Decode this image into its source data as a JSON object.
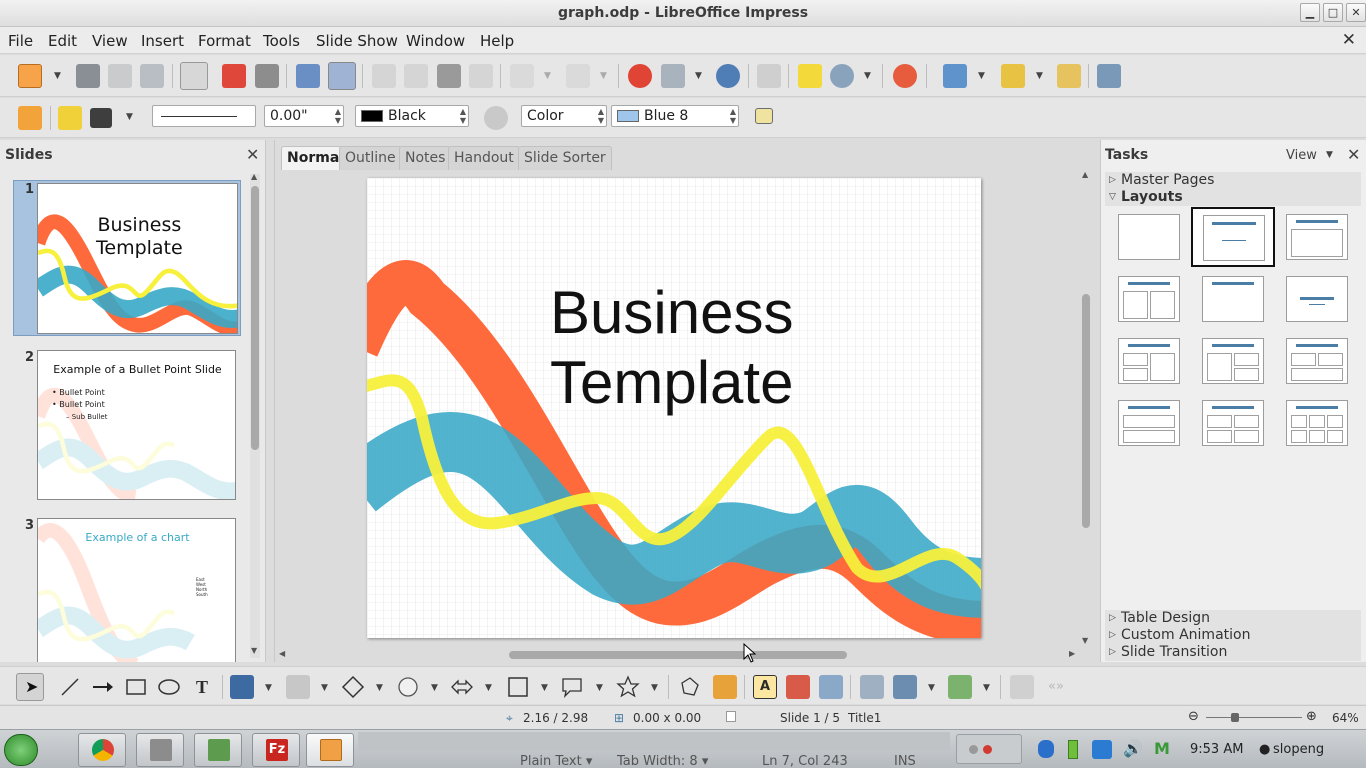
{
  "window": {
    "title": "graph.odp - LibreOffice Impress",
    "minimize": "▁",
    "maximize": "□",
    "close": "✕"
  },
  "menu": [
    "File",
    "Edit",
    "View",
    "Insert",
    "Format",
    "Tools",
    "Slide Show",
    "Window",
    "Help"
  ],
  "doc_close": "✕",
  "line_toolbar": {
    "line_width": "0.00\"",
    "line_color": "Black",
    "line_color_hex": "#000000",
    "area_style": "Color",
    "area_fill": "Blue 8",
    "area_fill_hex": "#9fc6ea"
  },
  "slides_panel": {
    "title": "Slides",
    "close": "✕",
    "thumbnails": [
      {
        "number": "1",
        "title_line1": "Business",
        "title_line2": "Template"
      },
      {
        "number": "2",
        "title": "Example of a Bullet Point Slide",
        "bullets": [
          "Bullet Point",
          "Bullet Point"
        ],
        "sub_bullet": "– Sub Bullet"
      },
      {
        "number": "3",
        "title": "Example of a chart",
        "legend": [
          "East",
          "West",
          "North",
          "South"
        ]
      }
    ]
  },
  "view_tabs": [
    "Normal",
    "Outline",
    "Notes",
    "Handout",
    "Slide Sorter"
  ],
  "slide": {
    "title_line1": "Business",
    "title_line2": "Template"
  },
  "tasks_panel": {
    "title": "Tasks",
    "view_label": "View",
    "close": "✕",
    "sections_top": [
      "Master Pages",
      "Layouts"
    ],
    "sections_bottom": [
      "Table Design",
      "Custom Animation",
      "Slide Transition"
    ],
    "selected_layout_index": 1
  },
  "status": {
    "position": "2.16 / 2.98",
    "size": "0.00 x 0.00",
    "slide": "Slide 1 / 5",
    "master": "Title1",
    "zoom": "64%"
  },
  "taskbar": {
    "bg_status": [
      "Plain Text ▾",
      "Tab Width:  8 ▾",
      "Ln 7, Col 243",
      "INS"
    ],
    "clock": "9:53 AM",
    "user": "slopeng"
  },
  "colors": {
    "orange_wave": "#ff6a3c",
    "blue_wave": "#39a9c7",
    "yellow_wave": "#f7f03c",
    "accent": "#4b7ea6"
  }
}
